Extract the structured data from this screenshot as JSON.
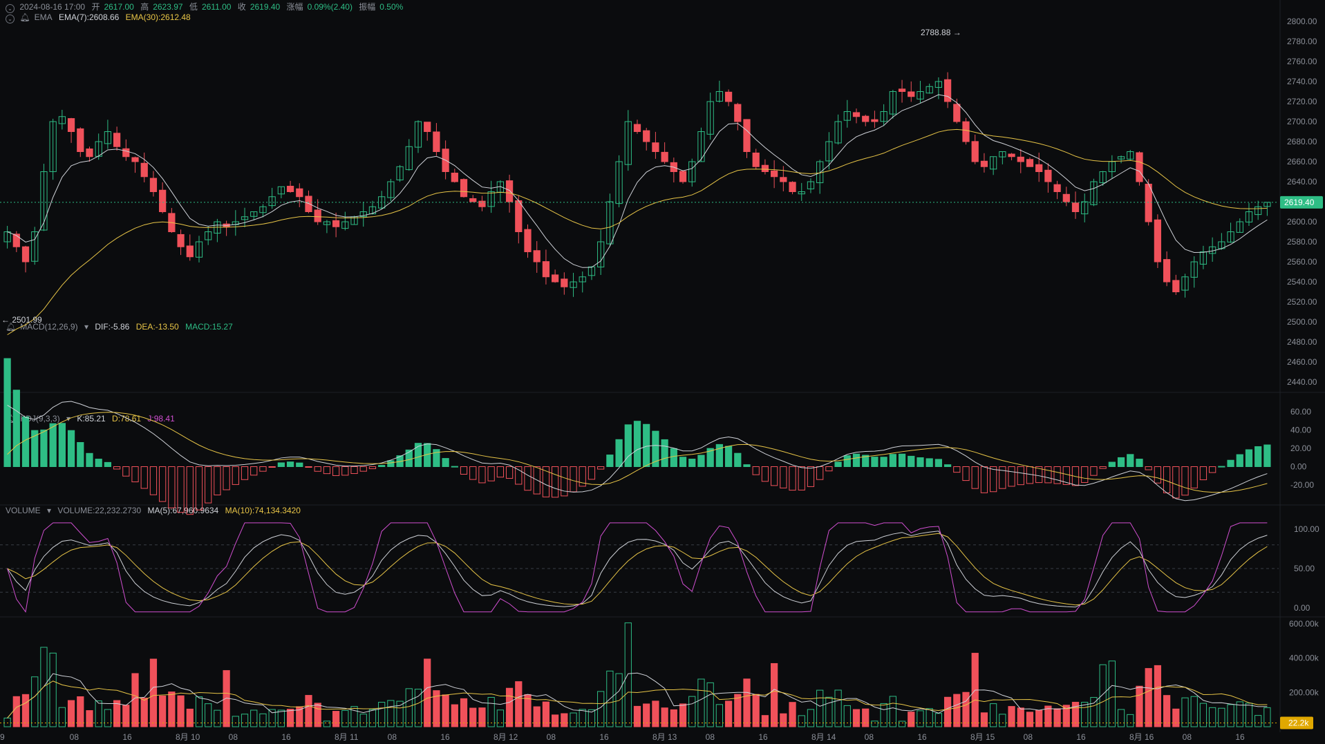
{
  "header": {
    "datetime": "2024-08-16 17:00",
    "open_label": "开",
    "open": "2617.00",
    "high_label": "高",
    "high": "2623.97",
    "low_label": "低",
    "low": "2611.00",
    "close_label": "收",
    "close": "2619.40",
    "change_label": "涨幅",
    "change": "0.09%(2.40)",
    "amp_label": "振幅",
    "amp": "0.50%"
  },
  "ema_legend": {
    "name": "EMA",
    "ema7": "EMA(7):2608.66",
    "ema30": "EMA(30):2612.48"
  },
  "macd_legend": {
    "name": "MACD(12,26,9)",
    "dif": "DIF:-5.86",
    "dea": "DEA:-13.50",
    "macd": "MACD:15.27"
  },
  "kdj_legend": {
    "name": "KDJ(9,3,3)",
    "k": "K:85.21",
    "d": "D:78.61",
    "j": "J:98.41"
  },
  "vol_legend": {
    "name": "VOLUME",
    "vol": "VOLUME:22,232.2730",
    "ma5": "MA(5):67,960.9634",
    "ma10": "MA(10):74,134.3420"
  },
  "price_tag": "2619.40",
  "volume_tag": "22.2k",
  "max_label": "2788.88",
  "min_label": "2501.99",
  "colors": {
    "up": "#2ebd85",
    "down": "#f0515a",
    "ema7": "#d0d3d9",
    "ema30": "#e8c547",
    "j": "#d14fd1",
    "tag_price": "#2ebd85",
    "tag_vol": "#e0a800"
  },
  "chart_data": {
    "type": "candlestick",
    "interval": "1h",
    "price_axis": {
      "ticks": [
        2800,
        2780,
        2760,
        2740,
        2720,
        2700,
        2680,
        2660,
        2640,
        2620,
        2600,
        2580,
        2560,
        2540,
        2520,
        2500,
        2480,
        2460,
        2440
      ],
      "labels": [
        "2800.00",
        "2780.00",
        "2760.00",
        "2740.00",
        "2720.00",
        "2700.00",
        "2680.00",
        "2660.00",
        "2640.00",
        "2620.00",
        "2600.00",
        "2580.00",
        "2560.00",
        "2540.00",
        "2520.00",
        "2500.00",
        "2480.00",
        "2460.00",
        "2440.00"
      ]
    },
    "macd_axis": {
      "ticks": [
        60,
        40,
        20,
        0,
        -20
      ],
      "labels": [
        "60.00",
        "40.00",
        "20.00",
        "0.00",
        "-20.00"
      ]
    },
    "kdj_axis": {
      "ticks": [
        100,
        50,
        0
      ],
      "labels": [
        "100.00",
        "50.00",
        "0.00"
      ]
    },
    "vol_axis": {
      "ticks": [
        600000,
        400000,
        200000
      ],
      "labels": [
        "600.00k",
        "400.00k",
        "200.00k"
      ]
    },
    "time_labels": [
      "9",
      "08",
      "16",
      "8月 10",
      "08",
      "16",
      "8月 11",
      "08",
      "16",
      "8月 12",
      "08",
      "16",
      "8月 13",
      "08",
      "16",
      "8月 14",
      "08",
      "16",
      "8月 15",
      "08",
      "16",
      "8月 16",
      "08",
      "16"
    ],
    "price_path": [
      2590,
      2575,
      2560,
      2590,
      2650,
      2700,
      2705,
      2690,
      2670,
      2665,
      2680,
      2690,
      2675,
      2665,
      2660,
      2645,
      2630,
      2610,
      2590,
      2575,
      2565,
      2580,
      2590,
      2600,
      2595,
      2600,
      2605,
      2610,
      2615,
      2625,
      2635,
      2630,
      2625,
      2610,
      2600,
      2600,
      2595,
      2600,
      2605,
      2610,
      2615,
      2625,
      2640,
      2655,
      2675,
      2700,
      2690,
      2670,
      2650,
      2640,
      2625,
      2620,
      2615,
      2630,
      2640,
      2620,
      2590,
      2570,
      2560,
      2545,
      2540,
      2535,
      2540,
      2545,
      2555,
      2580,
      2620,
      2660,
      2700,
      2690,
      2680,
      2670,
      2660,
      2650,
      2640,
      2660,
      2690,
      2720,
      2730,
      2720,
      2700,
      2670,
      2655,
      2650,
      2645,
      2640,
      2630,
      2630,
      2640,
      2660,
      2680,
      2700,
      2710,
      2705,
      2700,
      2700,
      2710,
      2730,
      2730,
      2725,
      2730,
      2735,
      2740,
      2720,
      2700,
      2680,
      2660,
      2655,
      2665,
      2670,
      2665,
      2660,
      2655,
      2650,
      2640,
      2630,
      2620,
      2610,
      2620,
      2640,
      2650,
      2660,
      2665,
      2670,
      2640,
      2600,
      2560,
      2540,
      2530,
      2545,
      2560,
      2570,
      2575,
      2580,
      2590,
      2600,
      2610,
      2615,
      2619.4
    ]
  }
}
